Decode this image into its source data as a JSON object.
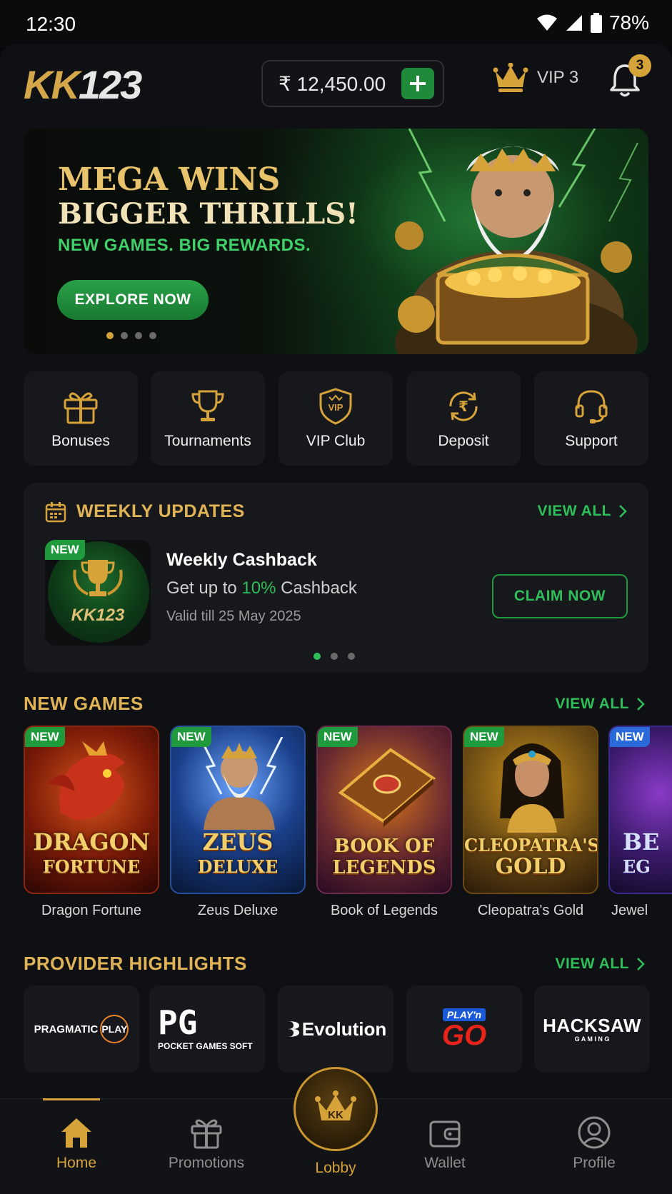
{
  "status_bar": {
    "time": "12:30",
    "battery": "78%"
  },
  "header": {
    "logo_letters": "KK",
    "logo_number": "123",
    "balance": "₹ 12,450.00",
    "add_funds_icon": "plus-icon",
    "vip_label": "VIP 3",
    "notification_count": "3"
  },
  "banner": {
    "title_line1": "MEGA WINS",
    "title_line2": "BIGGER THRILLS!",
    "subtitle": "NEW GAMES. BIG REWARDS.",
    "cta_label": "EXPLORE NOW"
  },
  "quick_actions": [
    {
      "label": "Bonuses",
      "icon": "gift-icon"
    },
    {
      "label": "Tournaments",
      "icon": "trophy-icon"
    },
    {
      "label": "VIP Club",
      "icon": "vip-shield-icon"
    },
    {
      "label": "Deposit",
      "icon": "rupee-refresh-icon"
    },
    {
      "label": "Support",
      "icon": "headset-icon"
    }
  ],
  "weekly": {
    "title": "WEEKLY UPDATES",
    "view_all": "VIEW ALL",
    "new_tag": "NEW",
    "badge_text": "KK123",
    "card_title": "Weekly Cashback",
    "desc_prefix": "Get up to ",
    "desc_highlight": "10%",
    "desc_suffix": " Cashback",
    "valid": "Valid till 25 May 2025",
    "claim_label": "CLAIM NOW"
  },
  "new_games": {
    "title": "NEW GAMES",
    "view_all": "VIEW ALL",
    "items": [
      {
        "tag": "NEW",
        "art_line1": "DRAGON",
        "art_line2": "FORTUNE",
        "name": "Dragon Fortune"
      },
      {
        "tag": "NEW",
        "art_line1": "ZEUS",
        "art_line2": "DELUXE",
        "name": "Zeus Deluxe"
      },
      {
        "tag": "NEW",
        "art_line1": "BOOK OF",
        "art_line2": "LEGENDS",
        "name": "Book of Legends"
      },
      {
        "tag": "NEW",
        "art_line1": "CLEOPATRA'S",
        "art_line2": "GOLD",
        "name": "Cleopatra's Gold"
      },
      {
        "tag": "NEW",
        "art_line1": "BE",
        "art_line2": "EG",
        "name": "Jewel"
      }
    ]
  },
  "providers": {
    "title": "PROVIDER HIGHLIGHTS",
    "view_all": "VIEW ALL",
    "items": [
      {
        "name": "PRAGMATIC",
        "name2": "PLAY"
      },
      {
        "name": "PG",
        "name2": "POCKET GAMES SOFT"
      },
      {
        "name": "Evolution"
      },
      {
        "name": "PLAY'n",
        "name2": "GO"
      },
      {
        "name": "HACKSAW",
        "name2": "G A M I N G"
      }
    ]
  },
  "bottom_nav": [
    {
      "label": "Home",
      "icon": "home-icon",
      "active": true
    },
    {
      "label": "Promotions",
      "icon": "gift-icon"
    },
    {
      "label": "Lobby",
      "icon": "crown-icon",
      "badge_text": "KK"
    },
    {
      "label": "Wallet",
      "icon": "wallet-icon"
    },
    {
      "label": "Profile",
      "icon": "profile-icon"
    }
  ],
  "colors": {
    "gold": "#d6a23a",
    "green": "#2fbf5a",
    "card": "#17181b",
    "bg": "#0f1013"
  }
}
